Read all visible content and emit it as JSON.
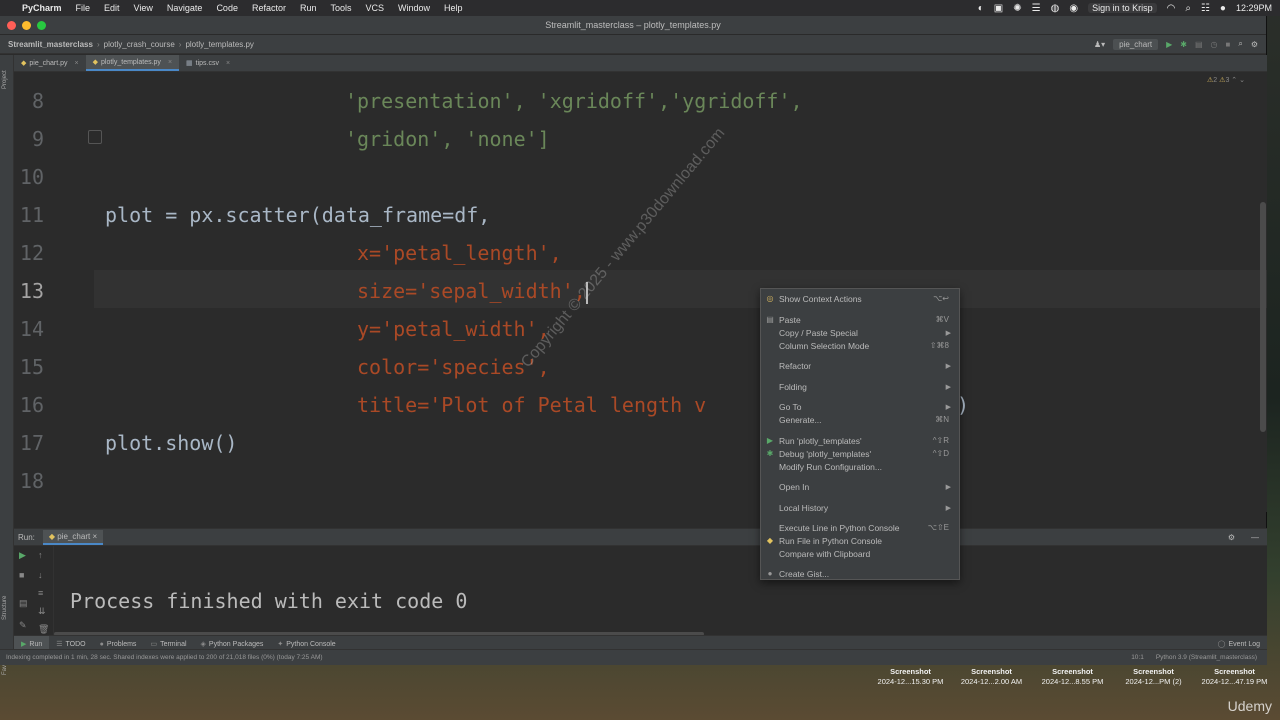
{
  "menubar": {
    "app_name": "PyCharm",
    "items": [
      "File",
      "Edit",
      "View",
      "Navigate",
      "Code",
      "Refactor",
      "Run",
      "Tools",
      "VCS",
      "Window",
      "Help"
    ],
    "krisp": "Sign in to Krisp",
    "time": "12:29PM"
  },
  "window": {
    "title": "Streamlit_masterclass – plotly_templates.py"
  },
  "navbar": {
    "crumbs": [
      "Streamlit_masterclass",
      "plotly_crash_course",
      "plotly_templates.py"
    ],
    "run_config": "pie_chart"
  },
  "tabs": [
    {
      "label": "pie_chart.py",
      "icon": "python-file-icon",
      "active": false
    },
    {
      "label": "plotly_templates.py",
      "icon": "python-file-icon",
      "active": true
    },
    {
      "label": "tips.csv",
      "icon": "csv-file-icon",
      "active": false
    }
  ],
  "side_labels": {
    "project": "Project",
    "structure": "Structure",
    "favorites": "Favorites"
  },
  "inspections": {
    "warnings": "2",
    "weak": "3"
  },
  "editor": {
    "lines": [
      {
        "num": "8",
        "text": "'presentation', 'xgridoff','ygridoff',"
      },
      {
        "num": "9",
        "text": "'gridon', 'none']"
      },
      {
        "num": "10",
        "text": ""
      },
      {
        "num": "11",
        "text": "plot = px.scatter(data_frame=df,"
      },
      {
        "num": "12",
        "text": "x='petal_length',"
      },
      {
        "num": "13",
        "text": "size='sepal_width',"
      },
      {
        "num": "14",
        "text": "y='petal_width',"
      },
      {
        "num": "15",
        "text": "color='species',"
      },
      {
        "num": "16",
        "text": "title='Plot of Petal length v"
      },
      {
        "num": "17",
        "text": "plot.show()"
      },
      {
        "num": "18",
        "text": ""
      }
    ],
    "line16_tail": ")",
    "watermark": "Copyright © 2025 - www.p30download.com"
  },
  "run_panel": {
    "label": "Run:",
    "tab": "pie_chart",
    "output": "Process finished with exit code 0"
  },
  "bottom_tabs": [
    "Run",
    "TODO",
    "Problems",
    "Terminal",
    "Python Packages",
    "Python Console"
  ],
  "event_log": "Event Log",
  "status": {
    "message": "Indexing completed in 1 min, 28 sec. Shared indexes were applied to 200 of 21,018 files (0%) (today 7:25 AM)",
    "position": "10:1",
    "interpreter": "Python 3.9 (Streamlit_masterclass)"
  },
  "context_menu": [
    {
      "label": "Show Context Actions",
      "shortcut": "⌥↩",
      "icon": "bulb-icon",
      "submenu": false
    },
    {
      "label": "Paste",
      "shortcut": "⌘V",
      "icon": "paste-icon",
      "submenu": false
    },
    {
      "label": "Copy / Paste Special",
      "shortcut": "",
      "icon": "",
      "submenu": true
    },
    {
      "label": "Column Selection Mode",
      "shortcut": "⇧⌘8",
      "icon": "",
      "submenu": false
    },
    {
      "label": "Refactor",
      "shortcut": "",
      "icon": "",
      "submenu": true
    },
    {
      "label": "Folding",
      "shortcut": "",
      "icon": "",
      "submenu": true
    },
    {
      "label": "Go To",
      "shortcut": "",
      "icon": "",
      "submenu": true
    },
    {
      "label": "Generate...",
      "shortcut": "⌘N",
      "icon": "",
      "submenu": false
    },
    {
      "label": "Run 'plotly_templates'",
      "shortcut": "^⇧R",
      "icon": "run-icon",
      "submenu": false
    },
    {
      "label": "Debug 'plotly_templates'",
      "shortcut": "^⇧D",
      "icon": "debug-icon",
      "submenu": false
    },
    {
      "label": "Modify Run Configuration...",
      "shortcut": "",
      "icon": "",
      "submenu": false
    },
    {
      "label": "Open In",
      "shortcut": "",
      "icon": "",
      "submenu": true
    },
    {
      "label": "Local History",
      "shortcut": "",
      "icon": "",
      "submenu": true
    },
    {
      "label": "Execute Line in Python Console",
      "shortcut": "⌥⇧E",
      "icon": "",
      "submenu": false
    },
    {
      "label": "Run File in Python Console",
      "shortcut": "",
      "icon": "python-icon",
      "submenu": false
    },
    {
      "label": "Compare with Clipboard",
      "shortcut": "",
      "icon": "",
      "submenu": false
    },
    {
      "label": "Create Gist...",
      "shortcut": "",
      "icon": "github-icon",
      "submenu": false
    }
  ],
  "desktop_files": [
    {
      "name": "Screenshot",
      "date": "2024-12...15.30 PM"
    },
    {
      "name": "Screenshot",
      "date": "2024-12...2.00 AM"
    },
    {
      "name": "Screenshot",
      "date": "2024-12...8.55 PM"
    },
    {
      "name": "Screenshot",
      "date": "2024-12...PM (2)"
    },
    {
      "name": "Screenshot",
      "date": "2024-12...47.19 PM"
    }
  ],
  "udemy": "Udemy"
}
